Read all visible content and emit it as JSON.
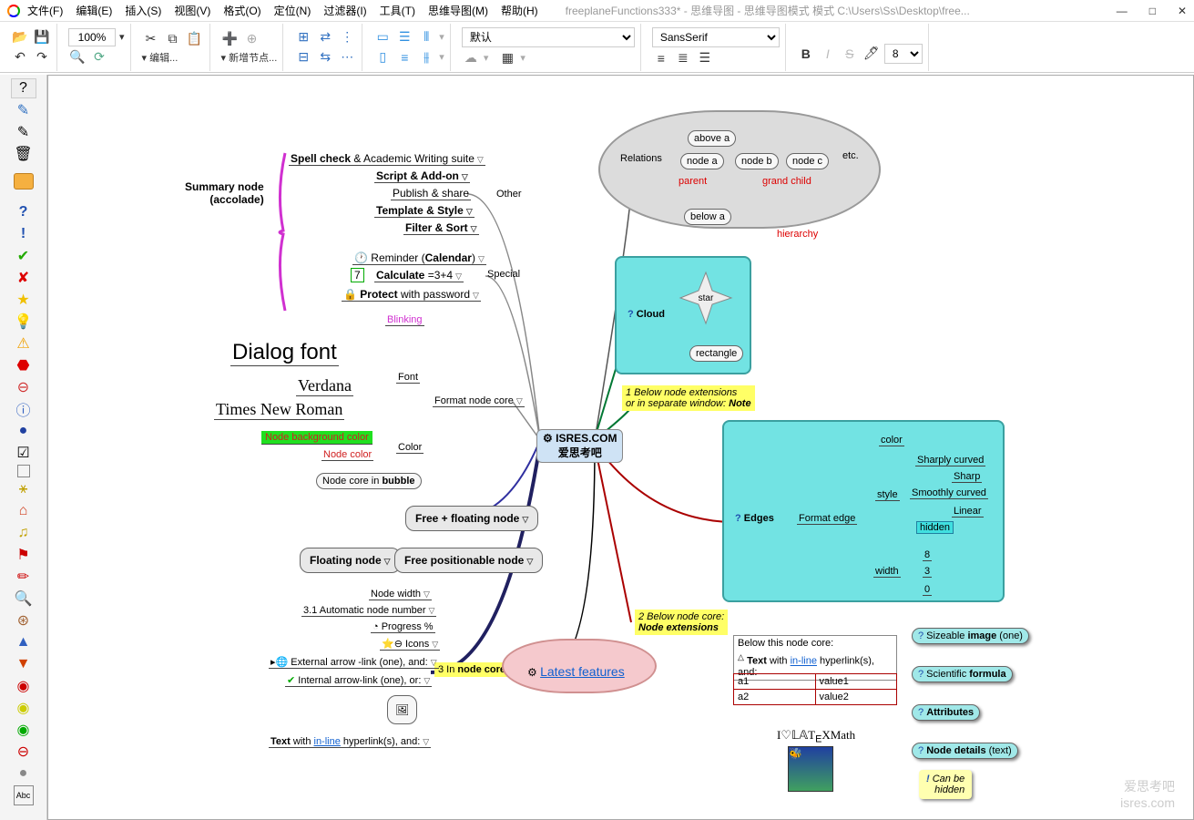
{
  "menu": {
    "file": "文件(F)",
    "edit": "编辑(E)",
    "insert": "插入(S)",
    "view": "视图(V)",
    "format": "格式(O)",
    "nav": "定位(N)",
    "filter": "过滤器(I)",
    "tools": "工具(T)",
    "mindmap": "思维导图(M)",
    "help": "帮助(H)"
  },
  "title": "freeplaneFunctions333* - 思维导图 - 思维导图模式 模式 C:\\Users\\Ss\\Desktop\\free...",
  "winctrl": {
    "min": "—",
    "max": "□",
    "close": "✕"
  },
  "tb": {
    "zoom": "100%",
    "edit_label": "▾ 编辑...",
    "newnode_label": "▾ 新增节点...",
    "style_sel": "默认",
    "font_sel": "SansSerif",
    "size_sel": "8"
  },
  "summary": {
    "l1": "Summary node",
    "l2": "(accolade)"
  },
  "other_group": {
    "label": "Other",
    "spell": "Spell check & Academic Writing suite",
    "script": "Script & Add-on",
    "publish": "Publish & share",
    "template": "Template & Style",
    "filter": "Filter & Sort"
  },
  "special_group": {
    "label": "Special",
    "reminder": "Reminder (Calendar)",
    "calc": "Calculate =3+4",
    "calc_val": "7",
    "protect": "Protect with password"
  },
  "format_core": {
    "label": "Format node core",
    "font_label": "Font",
    "blinking": "Blinking",
    "dialog": "Dialog font",
    "verdana": "Verdana",
    "times": "Times New Roman",
    "color_label": "Color",
    "bgcolor": "Node background color",
    "nodecolor": "Node color",
    "bubble": "Node core in bubble"
  },
  "free1": "Free + floating node",
  "floating": "Floating node",
  "free2": "Free positionable node",
  "incore": {
    "label": "3 In node core",
    "width": "Node width",
    "auto": "3.1 Automatic node number",
    "progress": "Progress %",
    "icons": "Icons",
    "extarrow": "External arrow -link (one), and:",
    "intarrow": "Internal arrow-link (one), or:",
    "text": "Text with in-line hyperlink(s), and:"
  },
  "root": {
    "l1": "ISRES.COM",
    "l2": "爱思考吧"
  },
  "relations": {
    "label": "Relations",
    "etc": "etc.",
    "above": "above a",
    "nodea": "node a",
    "nodeb": "node b",
    "nodec": "node c",
    "below": "below a",
    "parent": "parent",
    "grandchild": "grand child",
    "hierarchy": "hierarchy"
  },
  "cloud": {
    "label": "Cloud",
    "star": "star",
    "rect": "rectangle"
  },
  "note1": {
    "l1": "1 Below node extensions",
    "l2": "or in separate window: Note"
  },
  "note2": {
    "l1": "2 Below node core:",
    "l2": "Node extensions"
  },
  "edges": {
    "label": "Edges",
    "format": "Format edge",
    "color": "color",
    "style": "style",
    "s1": "Sharply curved",
    "s2": "Sharp",
    "s3": "Smoothly curved",
    "s4": "Linear",
    "s5": "hidden",
    "wlabel": "width",
    "w1": "8",
    "w2": "3",
    "w3": "0"
  },
  "latest": "Latest features",
  "details": {
    "below": "Below this node core:",
    "text": "Text with in-line hyperlink(s), and:",
    "a1": "a1",
    "v1": "value1",
    "a2": "a2",
    "v2": "value2",
    "latex": "I♡LaTeXMath"
  },
  "rightlinks": {
    "image": "Sizeable image (one)",
    "formula": "Scientific formula",
    "attrs": "Attributes",
    "nodedet": "Node details (text)"
  },
  "canbe": {
    "l1": "Can be",
    "l2": "hidden"
  },
  "wm": {
    "l1": "爱思考吧",
    "l2": "isres.com"
  }
}
